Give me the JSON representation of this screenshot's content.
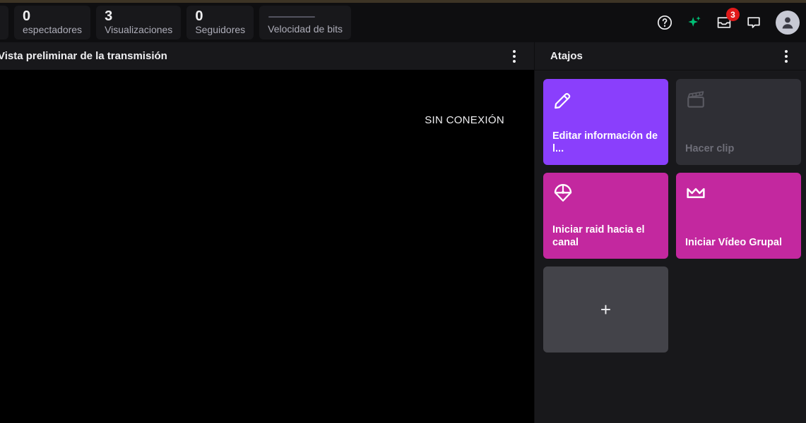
{
  "header": {
    "stats": [
      {
        "name": "partial-stat-card",
        "value": "",
        "label": ""
      },
      {
        "name": "viewers",
        "value": "0",
        "label": "espectadores"
      },
      {
        "name": "views",
        "value": "3",
        "label": "Visualizaciones"
      },
      {
        "name": "followers",
        "value": "0",
        "label": "Seguidores"
      },
      {
        "name": "bitrate",
        "value": "",
        "label": "Velocidad de bits"
      }
    ],
    "actions": [
      {
        "name": "help-icon",
        "title": "Ayuda"
      },
      {
        "name": "sparkle-icon",
        "title": "Novedades"
      },
      {
        "name": "inbox-icon",
        "title": "Bandeja de entrada",
        "badge": "3"
      },
      {
        "name": "chat-icon",
        "title": "Mensajes"
      },
      {
        "name": "avatar",
        "title": "Cuenta"
      }
    ],
    "accent_color": "#3d3425",
    "badge_color": "#e01a1a"
  },
  "preview": {
    "title": "Vista preliminar de la transmisión",
    "offline_text": "SIN CONEXIÓN",
    "menu_label": "Más opciones",
    "background": "#000000"
  },
  "shortcuts": {
    "title": "Atajos",
    "menu_label": "Más opciones",
    "tiles": [
      {
        "name": "shortcut-edit-stream-info",
        "icon": "pencil-icon",
        "label": "Editar información de l...",
        "color": "#8a3ffc",
        "state": "enabled"
      },
      {
        "name": "shortcut-create-clip",
        "icon": "clapperboard-icon",
        "label": "Hacer clip",
        "color": "#2f2f35",
        "state": "disabled"
      },
      {
        "name": "shortcut-start-raid",
        "icon": "parachute-icon",
        "label": "Iniciar raid hacia el canal",
        "color": "#c3289f",
        "state": "enabled"
      },
      {
        "name": "shortcut-start-squad-stream",
        "icon": "crown-icon",
        "label": "Iniciar Vídeo Grupal",
        "color": "#c3289f",
        "state": "enabled"
      },
      {
        "name": "shortcut-add",
        "icon": "plus-icon",
        "label": "+",
        "color": "#434349",
        "state": "enabled"
      }
    ]
  },
  "annotation": {
    "name": "arrow-annotation",
    "direction": "up-right",
    "fill": "#fb4a42",
    "stroke": "#000000"
  }
}
